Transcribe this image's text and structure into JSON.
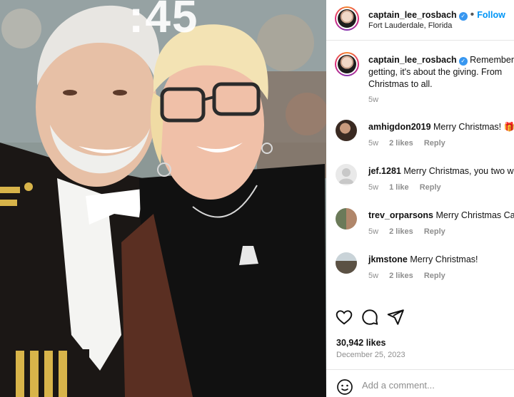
{
  "photo": {
    "overlay_text": ":45",
    "alt": "photo"
  },
  "header": {
    "username": "captain_lee_rosbach",
    "follow_label": "Follow",
    "location": "Fort Lauderdale, Florida",
    "dot": "•"
  },
  "caption": {
    "username": "captain_lee_rosbach",
    "line1": "Remember,",
    "line2": "getting, it's about the giving. From",
    "line3": "Christmas to all.",
    "time": "5w"
  },
  "comments": [
    {
      "username": "amhigdon2019",
      "text": "Merry Christmas! 🎁",
      "time": "5w",
      "likes": "2 likes",
      "reply": "Reply"
    },
    {
      "username": "jef.1281",
      "text": "Merry Christmas, you two w",
      "time": "5w",
      "likes": "1 like",
      "reply": "Reply"
    },
    {
      "username": "trev_orparsons",
      "text": "Merry Christmas Ca",
      "time": "5w",
      "likes": "2 likes",
      "reply": "Reply"
    },
    {
      "username": "jkmstone",
      "text": "Merry Christmas!",
      "time": "5w",
      "likes": "2 likes",
      "reply": "Reply"
    }
  ],
  "post": {
    "likes_count": "30,942 likes",
    "date": "December 25, 2023"
  },
  "add_comment": {
    "placeholder": "Add a comment..."
  },
  "colors": {
    "accent": "#0095f6",
    "verified": "#3897f0",
    "muted": "#8e8e8e"
  },
  "icons": [
    "heart-icon",
    "comment-icon",
    "share-icon",
    "emoji-icon",
    "verified-icon"
  ]
}
